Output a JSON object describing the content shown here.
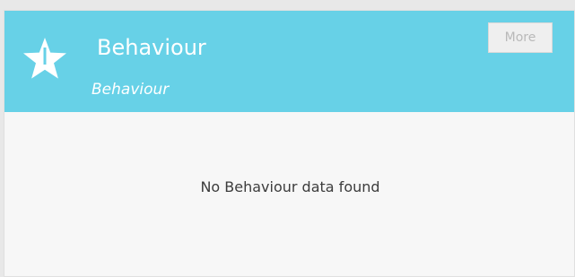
{
  "card": {
    "title": "Behaviour",
    "subtitle": "Behaviour",
    "icon": "star-icon",
    "header_color": "#67d1e7",
    "more_button_label": "More"
  },
  "body": {
    "empty_message": "No Behaviour data found"
  }
}
